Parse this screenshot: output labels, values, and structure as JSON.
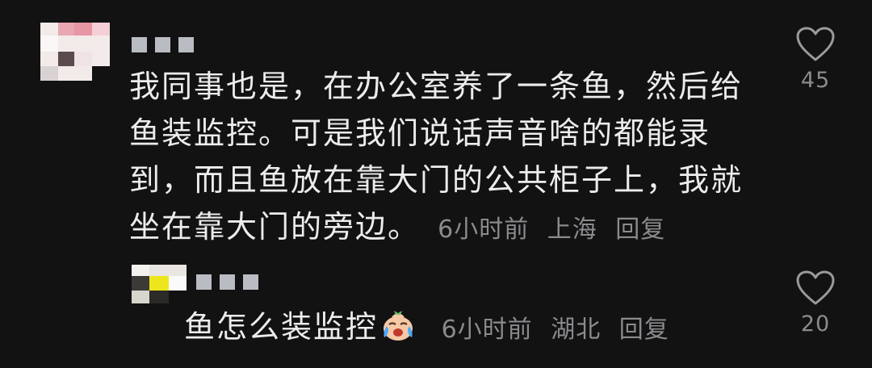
{
  "comments": [
    {
      "username_masked": "■■■",
      "text": "我同事也是，在办公室养了一条鱼，然后给鱼装监控。可是我们说话声音啥的都能录到，而且鱼放在靠大门的公共柜子上，我就坐在靠大门的旁边。",
      "lines": [
        "我同事也是，在办公室养了一条鱼，然后给",
        "鱼装监控。可是我们说话声音啥的都能录",
        "到，而且鱼放在靠大门的公共柜子上，我就",
        "坐在靠大门的旁边。"
      ],
      "time": "6小时前",
      "location": "上海",
      "reply_label": "回复",
      "like_count": "45",
      "like_icon": "heart-outline-icon"
    },
    {
      "username_masked": "■■■",
      "text": "鱼怎么装监控",
      "emoji": "crying-face-emoji",
      "time": "6小时前",
      "location": "湖北",
      "reply_label": "回复",
      "like_count": "20",
      "like_icon": "heart-outline-icon"
    }
  ],
  "colors": {
    "background": "#121212",
    "text": "#ececec",
    "meta": "#8b8b8f"
  }
}
